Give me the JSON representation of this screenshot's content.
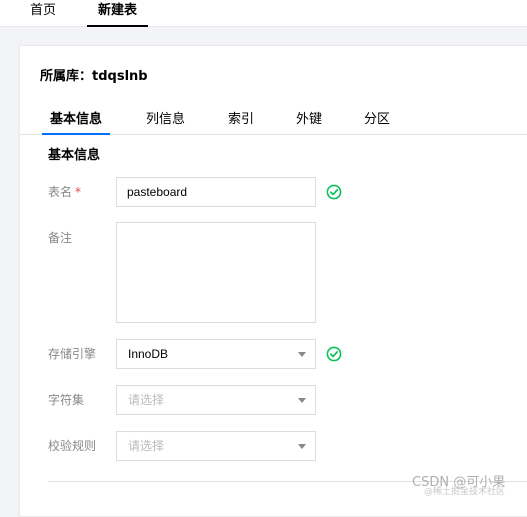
{
  "top_tabs": {
    "home": "首页",
    "new_table": "新建表"
  },
  "database": {
    "label": "所属库：tdqslnb"
  },
  "sub_tabs": [
    "基本信息",
    "列信息",
    "索引",
    "外键",
    "分区"
  ],
  "section": {
    "title": "基本信息"
  },
  "form": {
    "table_name": {
      "label": "表名",
      "required_mark": "*",
      "value": "pasteboard",
      "status_icon": "check-circle-icon"
    },
    "comment": {
      "label": "备注",
      "value": ""
    },
    "engine": {
      "label": "存储引擎",
      "value": "InnoDB",
      "status_icon": "check-circle-icon"
    },
    "charset": {
      "label": "字符集",
      "placeholder": "请选择"
    },
    "collation": {
      "label": "校验规则",
      "placeholder": "请选择"
    }
  },
  "watermark": {
    "line1": "CSDN @可小果",
    "line2": "@稀土掘金技术社区"
  },
  "colors": {
    "accent": "#006eff",
    "success": "#0abf5b",
    "required": "#e54545"
  }
}
